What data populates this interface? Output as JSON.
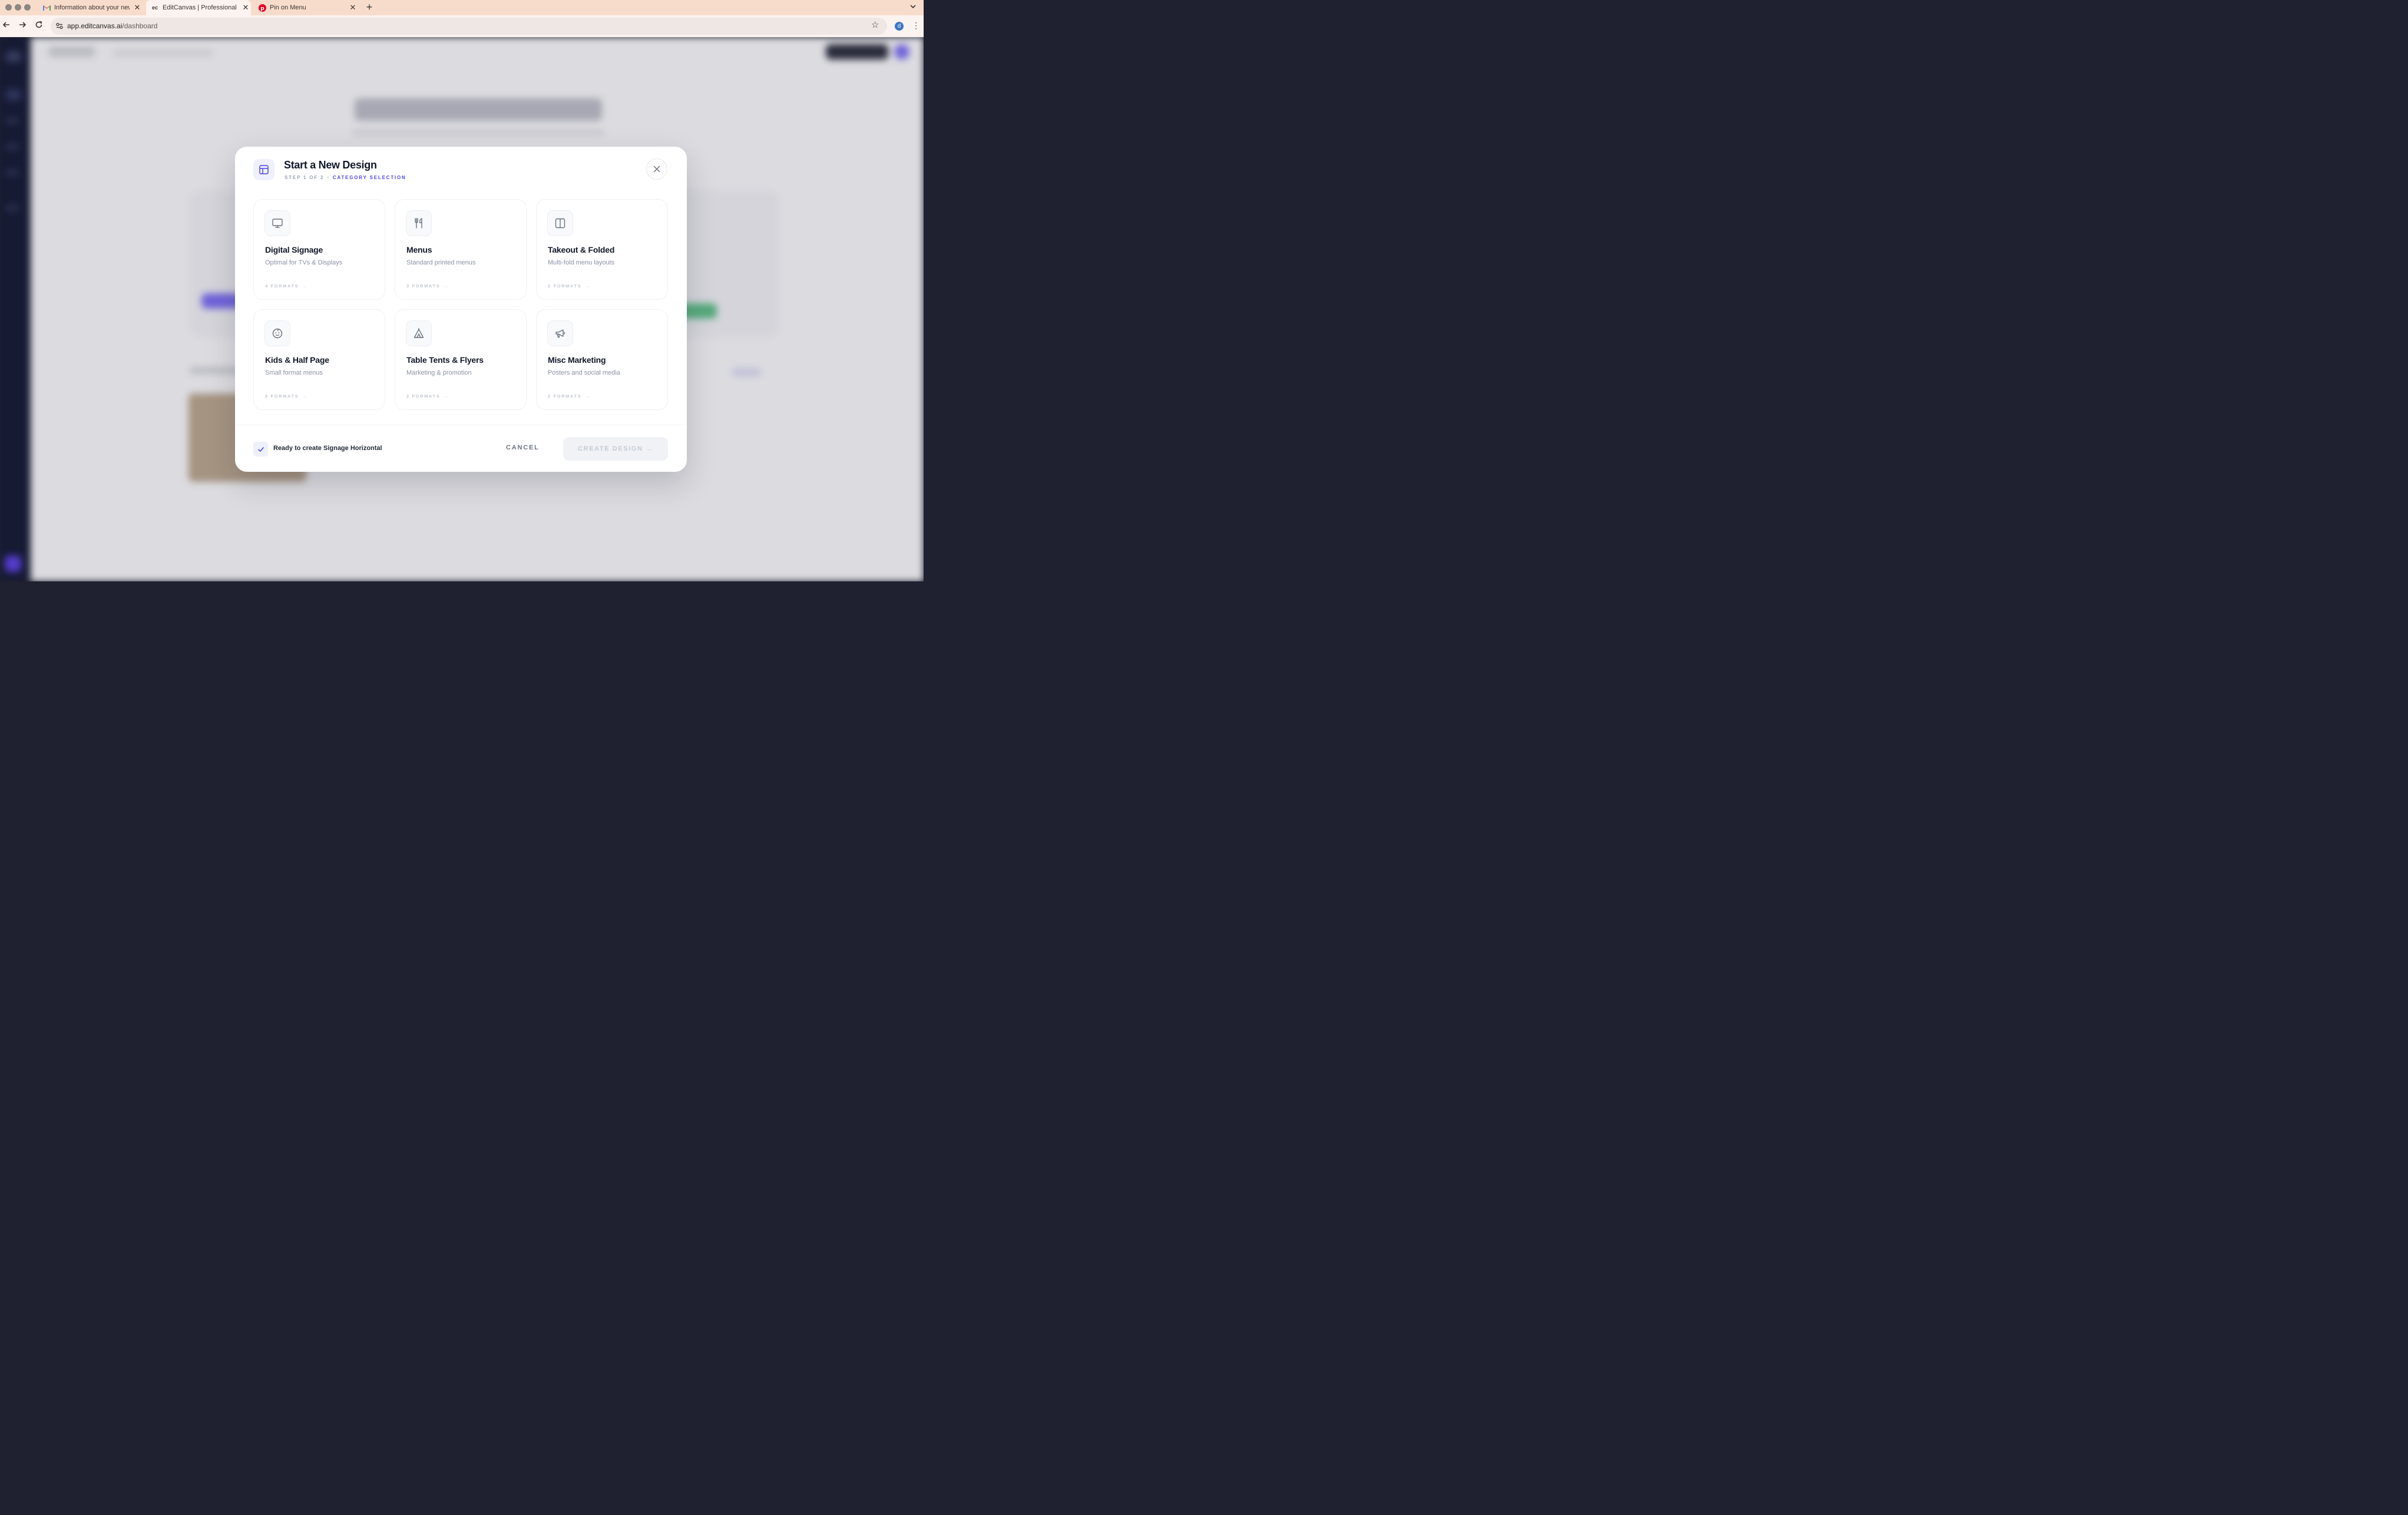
{
  "browser": {
    "tabs": [
      {
        "title": "Information about your new G",
        "favicon": "gmail-icon"
      },
      {
        "title": "EditCanvas | Professional Digi",
        "favicon": "ec"
      },
      {
        "title": "Pin on Menu",
        "favicon": "pinterest-icon"
      }
    ],
    "url_host": "app.editcanvas.ai",
    "url_path": "/dashboard",
    "profile_initial": "d"
  },
  "modal": {
    "title": "Start a New Design",
    "step": "STEP 1 OF 2",
    "step_separator": "•",
    "step_name": "CATEGORY SELECTION",
    "categories": [
      {
        "title": "Digital Signage",
        "description": "Optimal for TVs & Displays",
        "formats": "4 FORMATS",
        "icon": "monitor-icon"
      },
      {
        "title": "Menus",
        "description": "Standard printed menus",
        "formats": "3 FORMATS",
        "icon": "utensils-icon"
      },
      {
        "title": "Takeout & Folded",
        "description": "Multi-fold menu layouts",
        "formats": "2 FORMATS",
        "icon": "columns-icon"
      },
      {
        "title": "Kids & Half Page",
        "description": "Small format menus",
        "formats": "2 FORMATS",
        "icon": "baby-icon"
      },
      {
        "title": "Table Tents & Flyers",
        "description": "Marketing & promotion",
        "formats": "2 FORMATS",
        "icon": "tent-icon"
      },
      {
        "title": "Misc Marketing",
        "description": "Posters and social media",
        "formats": "2 FORMATS",
        "icon": "megaphone-icon"
      }
    ],
    "arrow": "→",
    "ready_text": "Ready to create Signage Horizontal",
    "cancel_label": "CANCEL",
    "create_label": "CREATE DESIGN →"
  },
  "colors": {
    "accent": "#4f46e5",
    "sidebar": "#141833",
    "tabbar": "#f8dccb"
  }
}
